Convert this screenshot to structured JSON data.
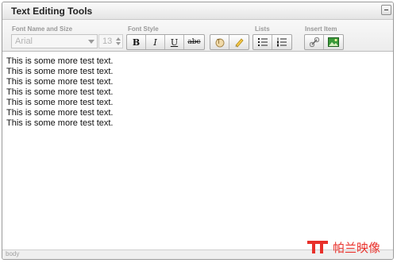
{
  "panel": {
    "title": "Text Editing Tools"
  },
  "toolbar": {
    "font_group_label": "Font Name and Size",
    "font_name": "Arial",
    "font_size": "13",
    "style_group_label": "Font Style",
    "bold_label": "B",
    "italic_label": "I",
    "underline_label": "U",
    "strike_label": "abc",
    "lists_group_label": "Lists",
    "insert_group_label": "Insert Item",
    "icons": [
      "text-color-icon",
      "highlight-marker-icon",
      "unordered-list-icon",
      "ordered-list-icon",
      "link-icon",
      "image-icon"
    ]
  },
  "content": {
    "lines": [
      "This is some more test text.",
      "This is some more test text.",
      "This is some more test text.",
      "This is some more test text.",
      "This is some more test text.",
      "This is some more test text.",
      "This is some more test text."
    ]
  },
  "status": {
    "path": "body"
  },
  "watermark": {
    "text": "帕兰映像",
    "color": "#e8302a"
  }
}
